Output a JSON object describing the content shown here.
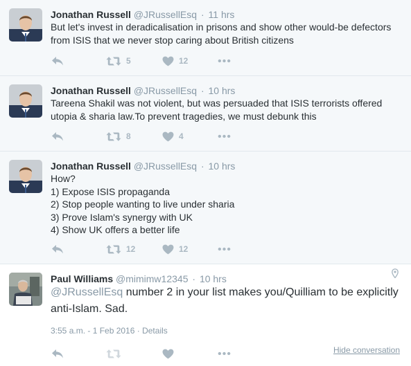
{
  "tweets": [
    {
      "name": "Jonathan Russell",
      "handle": "@JRussellEsq",
      "time": "11 hrs",
      "lines": [
        "But let's invest in deradicalisation in prisons and show other would-be defectors",
        "from ISIS that we never stop caring about British citizens"
      ],
      "retweets": "5",
      "likes": "12"
    },
    {
      "name": "Jonathan Russell",
      "handle": "@JRussellEsq",
      "time": "10 hrs",
      "lines": [
        "Tareena Shakil was not violent, but was persuaded that ISIS terrorists offered",
        "utopia & sharia law.To prevent tragedies, we must debunk this"
      ],
      "retweets": "8",
      "likes": "4"
    },
    {
      "name": "Jonathan Russell",
      "handle": "@JRussellEsq",
      "time": "10 hrs",
      "lines": [
        "How?",
        "1) Expose ISIS propaganda",
        "2) Stop people wanting to live under sharia",
        "3) Prove Islam's synergy with UK",
        "4) Show UK offers a better life"
      ],
      "retweets": "12",
      "likes": "12"
    }
  ],
  "focused": {
    "name": "Paul Williams",
    "handle": "@mimimw12345",
    "time": "10 hrs",
    "mention": "@JRussellEsq",
    "text_after_mention": " number 2 in your list makes you/Quilliam to be explicitly",
    "line2": "anti-Islam. Sad.",
    "timestamp": "3:55 a.m. - 1 Feb 2016",
    "details_label": "Details",
    "hide_conversation": "Hide conversation"
  },
  "icons": {
    "reply": "reply-icon",
    "retweet": "retweet-icon",
    "like": "heart-icon",
    "more": "more-icon",
    "location": "location-pin-icon"
  },
  "colors": {
    "background_thread": "#f5f8fa",
    "text": "#292f33",
    "muted": "#8899a6",
    "icon": "#aab8c2",
    "border": "#e1e8ed"
  }
}
